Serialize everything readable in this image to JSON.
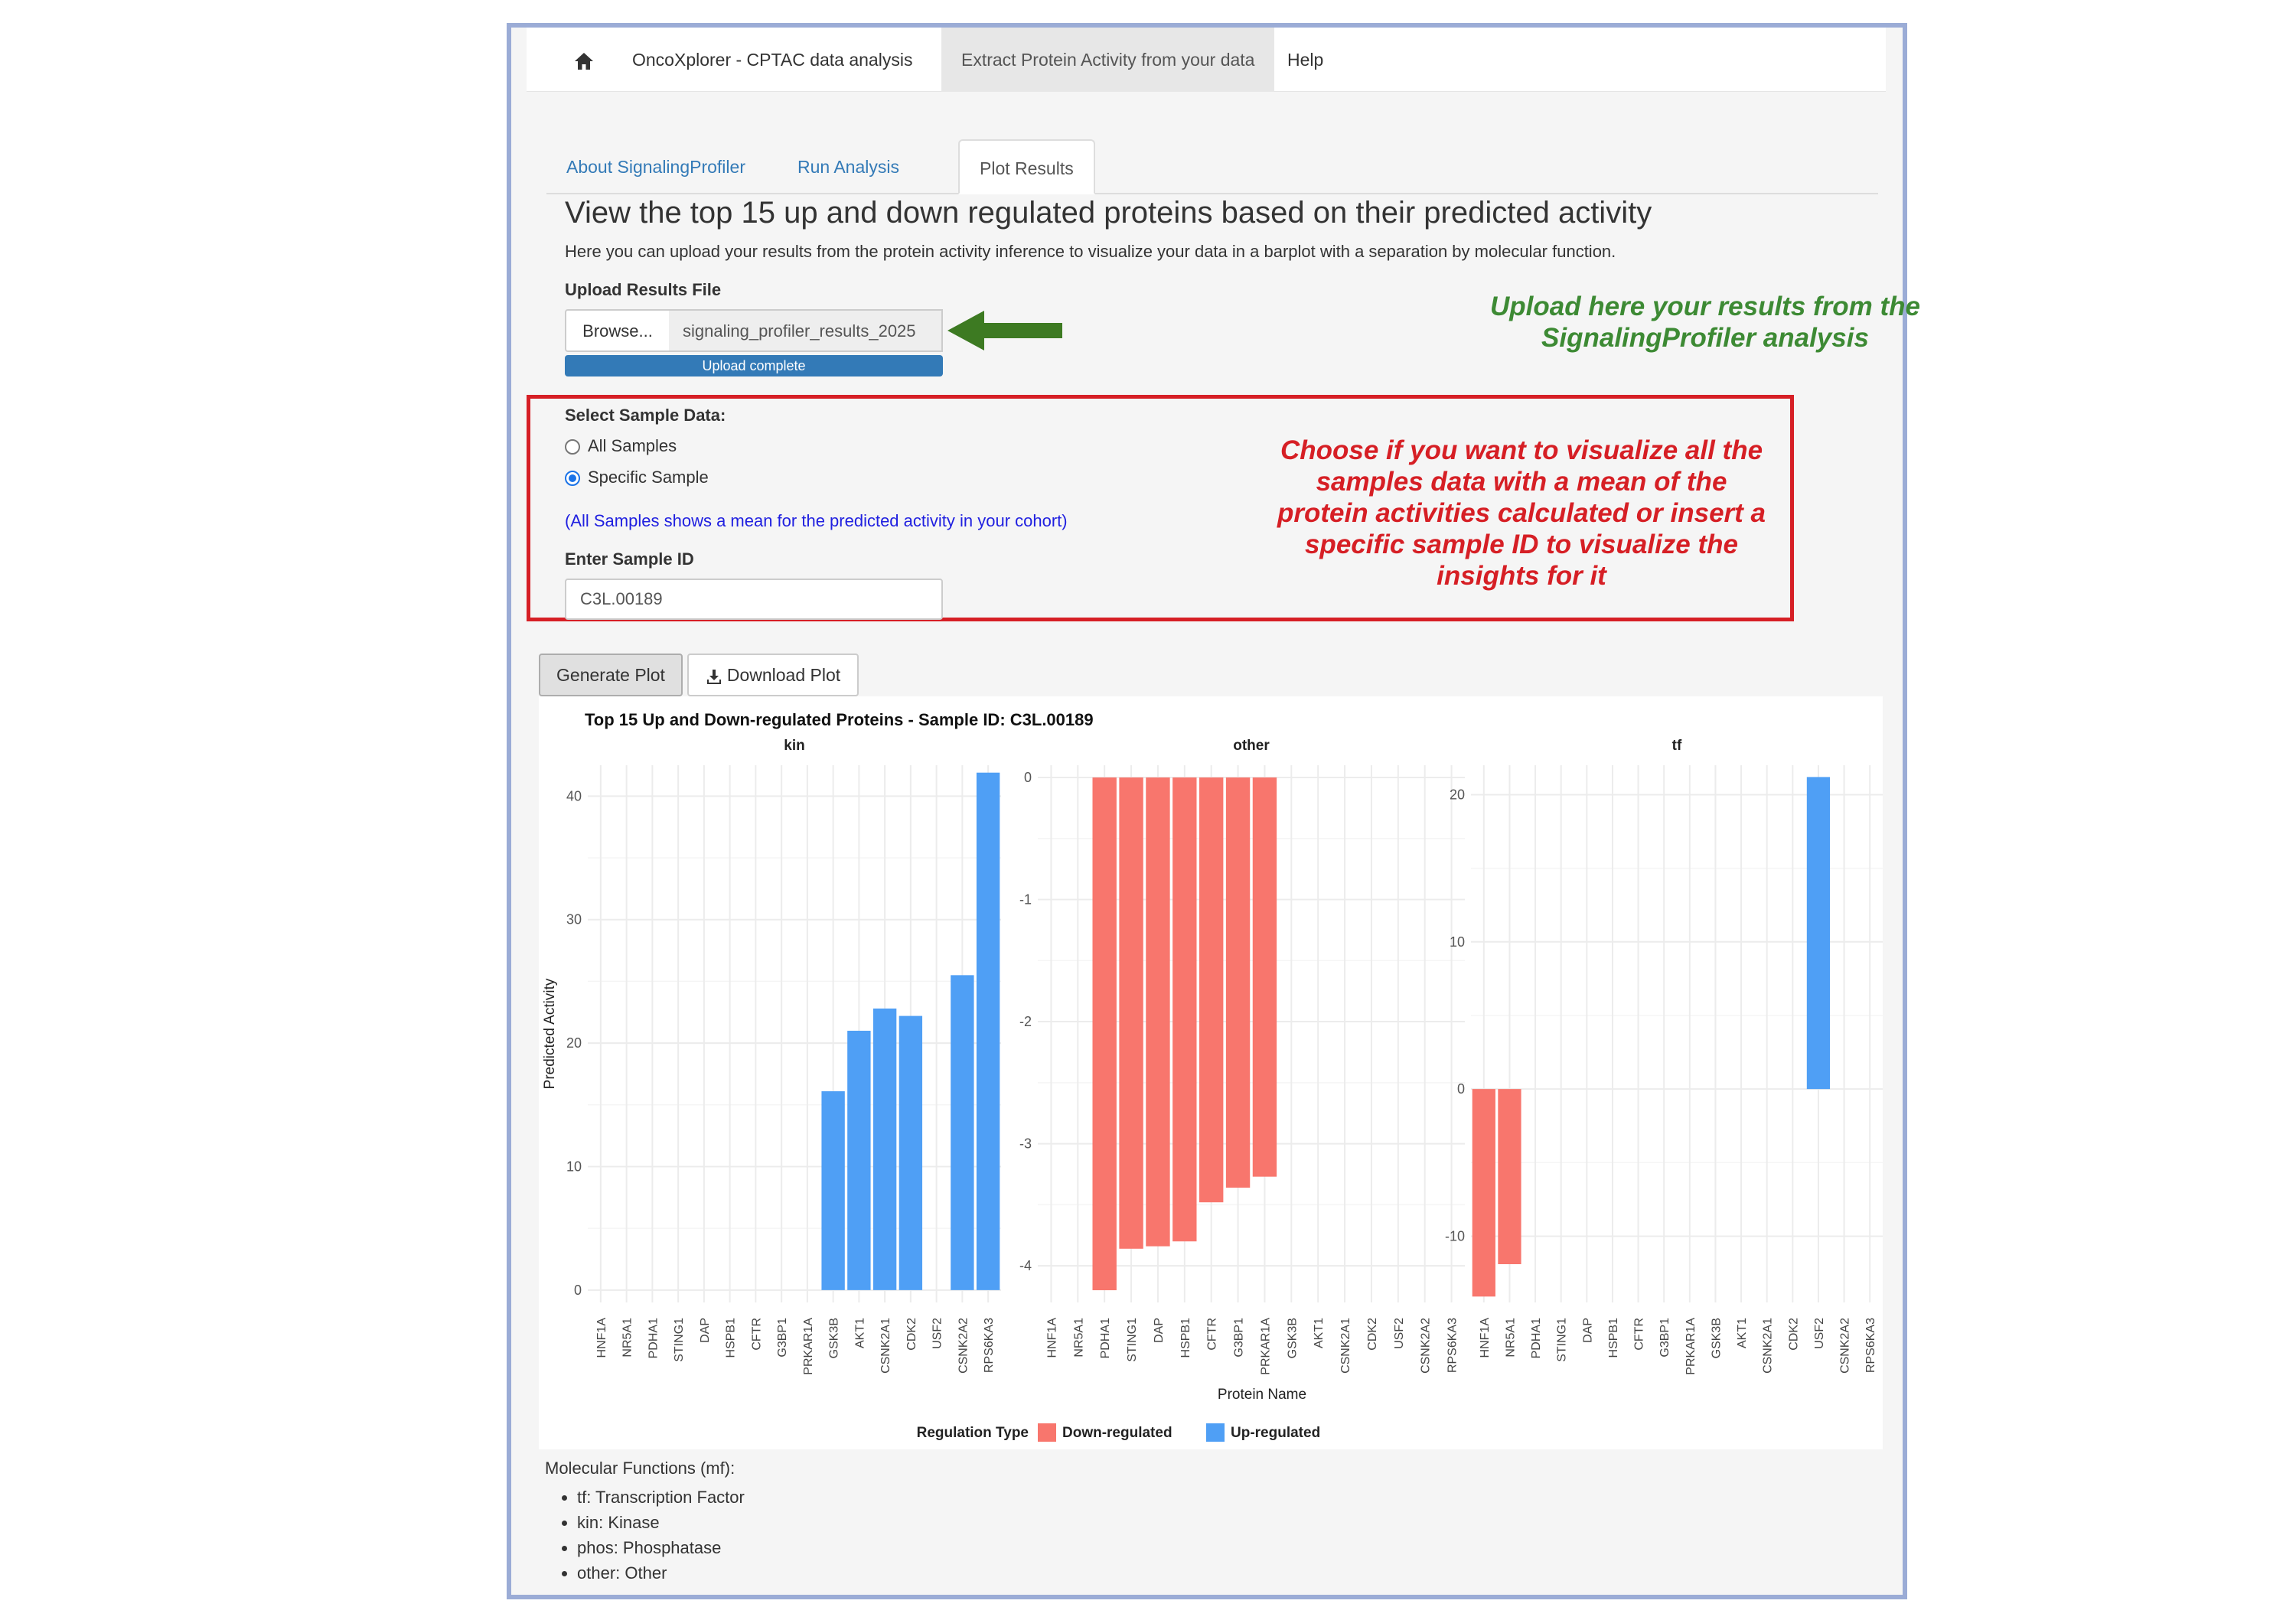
{
  "navbar": {
    "home_icon": "home-icon",
    "items": [
      "OncoXplorer - CPTAC data analysis",
      "Extract Protein Activity from your data",
      "Help"
    ]
  },
  "tabs": [
    "About SignalingProfiler",
    "Run Analysis",
    "Plot Results"
  ],
  "main": {
    "title": "View the top 15 up and down regulated proteins based on their predicted activity",
    "description": "Here you can upload your results from the protein activity inference to visualize your data in a barplot with a separation by molecular function.",
    "upload_label": "Upload Results File",
    "browse_label": "Browse...",
    "file_name": "signaling_profiler_results_2025",
    "upload_status": "Upload complete",
    "upload_annotation": "Upload here your results from the SignalingProfiler analysis",
    "select_label": "Select Sample Data:",
    "radio_all": "All Samples",
    "radio_specific": "Specific Sample",
    "radio_selected": "Specific Sample",
    "samples_note": "(All Samples shows a mean for the predicted activity in your cohort)",
    "sample_id_label": "Enter Sample ID",
    "sample_id_value": "C3L.00189",
    "select_annotation": "Choose if you want to visualize all the samples data with a mean of the protein activities calculated or insert a specific sample ID to visualize the insights for it",
    "generate_label": "Generate Plot",
    "download_label": "Download Plot"
  },
  "colors": {
    "down": "#f8766d",
    "up": "#4f9ff5",
    "annot_green": "#3d8a34",
    "annot_red": "#d61f25",
    "link": "#337ab7"
  },
  "chart_data": {
    "type": "bar",
    "title": "Top 15 Up and Down-regulated Proteins - Sample ID: C3L.00189",
    "xlabel": "Protein Name",
    "ylabel": "Predicted Activity",
    "legend_title": "Regulation Type",
    "legend": [
      "Down-regulated",
      "Up-regulated"
    ],
    "legend_position": "bottom",
    "categories": [
      "HNF1A",
      "NR5A1",
      "PDHA1",
      "STING1",
      "DAP",
      "HSPB1",
      "CFTR",
      "G3BP1",
      "PRKAR1A",
      "GSK3B",
      "AKT1",
      "CSNK2A1",
      "CDK2",
      "USF2",
      "CSNK2A2",
      "RPS6KA3"
    ],
    "facets": [
      {
        "name": "kin",
        "ylim": [
          -1,
          42.5
        ],
        "yticks": [
          0,
          10,
          20,
          30,
          40
        ],
        "values": [
          null,
          null,
          null,
          null,
          null,
          null,
          null,
          null,
          null,
          16.1,
          21.0,
          22.8,
          22.2,
          null,
          25.5,
          41.9
        ],
        "regulation": [
          null,
          null,
          null,
          null,
          null,
          null,
          null,
          null,
          null,
          "up",
          "up",
          "up",
          "up",
          null,
          "up",
          "up"
        ]
      },
      {
        "name": "other",
        "ylim": [
          -4.3,
          0.1
        ],
        "yticks": [
          0,
          -1,
          -2,
          -3,
          -4
        ],
        "values": [
          null,
          null,
          -4.2,
          -3.86,
          -3.84,
          -3.8,
          -3.48,
          -3.36,
          -3.27,
          null,
          null,
          null,
          null,
          null,
          null,
          null
        ],
        "regulation": [
          null,
          null,
          "down",
          "down",
          "down",
          "down",
          "down",
          "down",
          "down",
          null,
          null,
          null,
          null,
          null,
          null,
          null
        ]
      },
      {
        "name": "tf",
        "ylim": [
          -14.5,
          22
        ],
        "yticks": [
          -10,
          0,
          10,
          20
        ],
        "values": [
          -14.1,
          -11.9,
          null,
          null,
          null,
          null,
          null,
          null,
          null,
          null,
          null,
          null,
          null,
          21.2,
          null,
          null
        ],
        "regulation": [
          "down",
          "down",
          null,
          null,
          null,
          null,
          null,
          null,
          null,
          null,
          null,
          null,
          null,
          "up",
          null,
          null
        ]
      }
    ]
  },
  "molecular_functions": {
    "title": "Molecular Functions (mf):",
    "items": [
      "tf: Transcription Factor",
      "kin: Kinase",
      "phos: Phosphatase",
      "other: Other"
    ]
  }
}
